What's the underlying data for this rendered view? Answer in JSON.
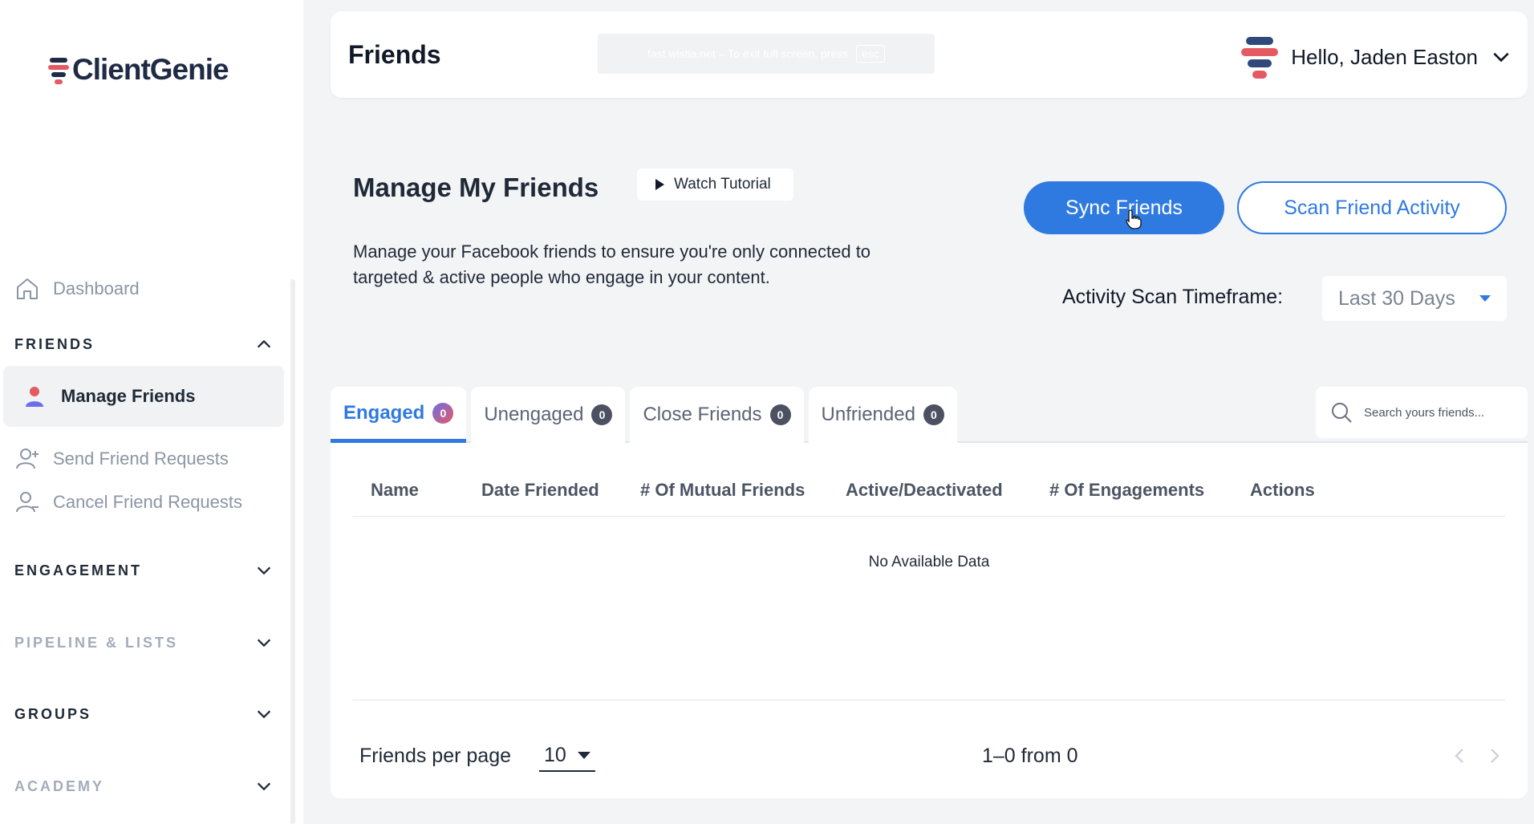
{
  "app": {
    "logo_text": "ClientGenie"
  },
  "colors": {
    "accent": "#2f7ae0",
    "logo_red": "#e45a63",
    "logo_navy": "#1f2a44"
  },
  "sidebar": {
    "dashboard": {
      "label": "Dashboard",
      "icon": "home-icon"
    },
    "sections": [
      {
        "id": "friends",
        "label": "FRIENDS",
        "expanded": true
      },
      {
        "id": "engagement",
        "label": "ENGAGEMENT",
        "expanded": false
      },
      {
        "id": "pipeline",
        "label": "PIPELINE & LISTS",
        "expanded": false
      },
      {
        "id": "groups",
        "label": "GROUPS",
        "expanded": false
      },
      {
        "id": "academy",
        "label": "ACADEMY",
        "expanded": false
      }
    ],
    "friends_items": [
      {
        "label": "Manage Friends",
        "icon": "user-icon",
        "active": true
      },
      {
        "label": "Send Friend Requests",
        "icon": "user-plus-icon"
      },
      {
        "label": "Cancel Friend Requests",
        "icon": "user-minus-icon"
      }
    ]
  },
  "header": {
    "title": "Friends",
    "fullscreen_notice": "fast.wistia.net – To exit full screen, press",
    "fullscreen_key": "esc",
    "user_greeting": "Hello, Jaden Easton"
  },
  "main": {
    "title": "Manage My Friends",
    "watch_tutorial": "Watch Tutorial",
    "description": "Manage your Facebook friends to ensure you're only connected to targeted & active people who engage in your content.",
    "sync_button": "Sync Friends",
    "scan_button": "Scan Friend Activity",
    "timeframe_label": "Activity Scan Timeframe:",
    "timeframe_value": "Last 30 Days",
    "tabs": [
      {
        "label": "Engaged",
        "count": "0",
        "active": true
      },
      {
        "label": "Unengaged",
        "count": "0"
      },
      {
        "label": "Close Friends",
        "count": "0"
      },
      {
        "label": "Unfriended",
        "count": "0"
      }
    ],
    "search_placeholder": "Search yours friends...",
    "table": {
      "columns": [
        "Name",
        "Date Friended",
        "# Of Mutual Friends",
        "Active/Deactivated",
        "# Of Engagements",
        "Actions"
      ],
      "empty_text": "No Available Data"
    },
    "pagination": {
      "per_page_label": "Friends per page",
      "per_page_value": "10",
      "range_text": "1–0 from 0"
    }
  }
}
